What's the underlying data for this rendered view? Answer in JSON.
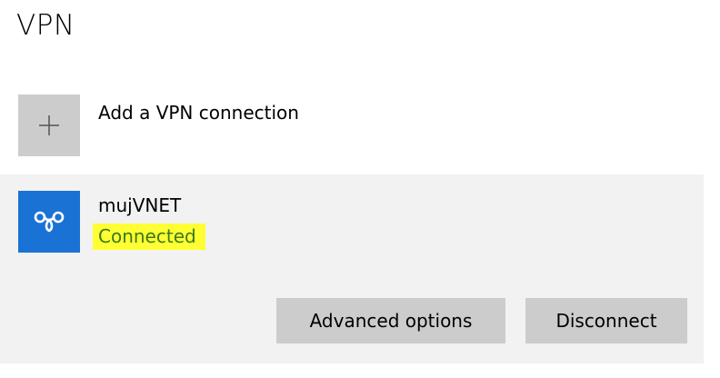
{
  "page": {
    "title": "VPN"
  },
  "add_connection": {
    "label": "Add a VPN connection",
    "icon": "plus-icon"
  },
  "connection": {
    "name": "mujVNET",
    "status": "Connected",
    "icon": "vpn-connection-icon",
    "status_highlight_color": "#ffff33",
    "tile_color": "#1a73d4",
    "buttons": {
      "advanced_label": "Advanced options",
      "disconnect_label": "Disconnect"
    }
  }
}
